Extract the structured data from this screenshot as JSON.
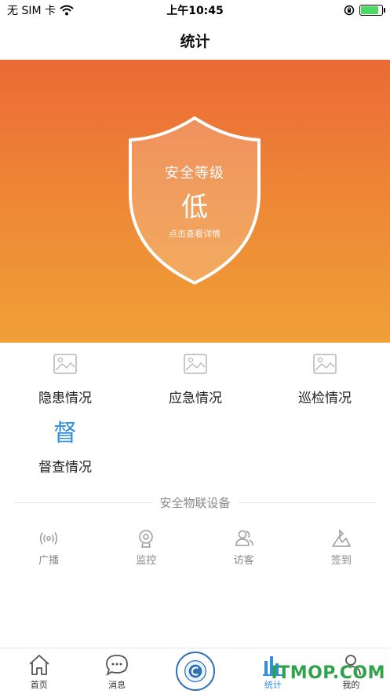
{
  "status_bar": {
    "carrier": "无 SIM 卡",
    "time": "上午10:45",
    "battery_level": 0.85
  },
  "nav": {
    "title": "统计"
  },
  "hero": {
    "shield_title": "安全等级",
    "shield_level": "低",
    "shield_hint": "点击查看详情"
  },
  "grid": [
    {
      "label": "隐患情况",
      "icon": "image-placeholder-icon"
    },
    {
      "label": "应急情况",
      "icon": "image-placeholder-icon"
    },
    {
      "label": "巡检情况",
      "icon": "image-placeholder-icon"
    },
    {
      "label": "督查情况",
      "icon": "du-glyph-icon",
      "glyph": "督"
    }
  ],
  "iot": {
    "heading": "安全物联设备",
    "devices": [
      {
        "label": "广播",
        "icon": "broadcast-icon"
      },
      {
        "label": "监控",
        "icon": "camera-icon"
      },
      {
        "label": "访客",
        "icon": "visitor-icon"
      },
      {
        "label": "签到",
        "icon": "checkin-icon"
      }
    ]
  },
  "tabs": [
    {
      "label": "首页",
      "icon": "home-icon"
    },
    {
      "label": "消息",
      "icon": "message-icon"
    },
    {
      "label": "",
      "icon": "center-logo-icon"
    },
    {
      "label": "统计",
      "icon": "stats-icon",
      "active": true
    },
    {
      "label": "我的",
      "icon": "profile-icon"
    }
  ],
  "watermark": "ITMOP.COM",
  "colors": {
    "accent": "#2f8ee0",
    "hero_top": "#ec6a36",
    "hero_bottom": "#f0a038",
    "watermark": "#2fa24a"
  }
}
